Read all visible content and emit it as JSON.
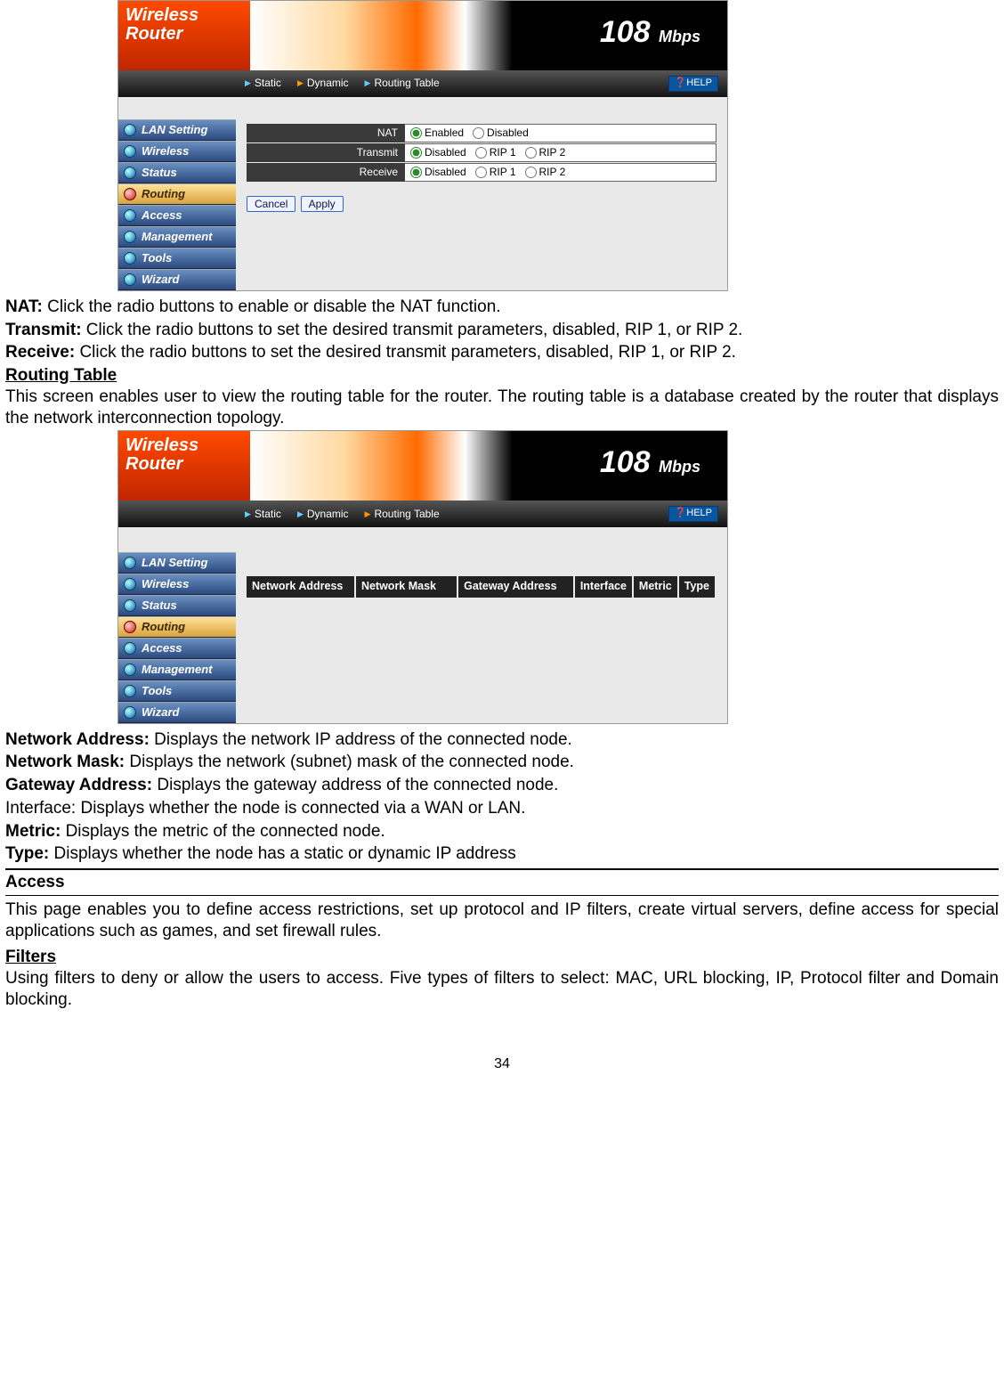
{
  "logo": {
    "line1": "Wireless",
    "line2": "Router"
  },
  "banner": {
    "speed": "108",
    "unit": "Mbps"
  },
  "tabs": {
    "static": "Static",
    "dynamic": "Dynamic",
    "routing_table": "Routing Table",
    "help": "HELP"
  },
  "sidebar": {
    "lan": "LAN Setting",
    "wireless": "Wireless",
    "status": "Status",
    "routing": "Routing",
    "access": "Access",
    "management": "Management",
    "tools": "Tools",
    "wizard": "Wizard"
  },
  "config": {
    "nat_label": "NAT",
    "nat_enabled": "Enabled",
    "nat_disabled": "Disabled",
    "transmit_label": "Transmit",
    "receive_label": "Receive",
    "opt_disabled": "Disabled",
    "opt_rip1": "RIP 1",
    "opt_rip2": "RIP 2",
    "cancel": "Cancel",
    "apply": "Apply"
  },
  "table_headers": {
    "netaddr": "Network Address",
    "netmask": "Network Mask",
    "gateway": "Gateway Address",
    "iface": "Interface",
    "metric": "Metric",
    "type": "Type"
  },
  "doc": {
    "nat_lbl": "NAT:",
    "nat_txt": " Click the radio buttons to enable or disable the NAT function.",
    "tx_lbl": "Transmit:",
    "tx_txt": " Click the radio buttons to set the desired transmit parameters, disabled, RIP 1, or RIP 2.",
    "rx_lbl": "Receive:",
    "rx_txt": " Click the radio buttons to set the desired transmit parameters, disabled, RIP 1, or RIP 2.",
    "rt_heading": "Routing Table",
    "rt_para": "This screen enables user to view the routing table for the router. The routing table is a database created by the router that displays the network interconnection topology.",
    "na_lbl": "Network Address:",
    "na_txt": " Displays the network IP address of the connected node.",
    "nm_lbl": "Network Mask:",
    "nm_txt": " Displays the network (subnet) mask of the connected node.",
    "ga_lbl": "Gateway Address:",
    "ga_txt": " Displays the gateway address of the connected node.",
    "if_txt": "Interface: Displays whether the node is connected via a WAN or LAN.",
    "me_lbl": "Metric:",
    "me_txt": " Displays the metric of the connected node.",
    "ty_lbl": "Type:",
    "ty_txt": " Displays whether the node has a static or dynamic IP address",
    "access_h": "Access",
    "access_p": "This page enables you to define access restrictions, set up protocol and IP filters, create virtual servers, define access for special applications such as games, and set firewall rules.",
    "filters_h": "Filters",
    "filters_p": "Using filters to deny or allow the users to access.  Five types of filters to select: MAC, URL blocking, IP, Protocol filter and Domain blocking.",
    "page": "34"
  }
}
